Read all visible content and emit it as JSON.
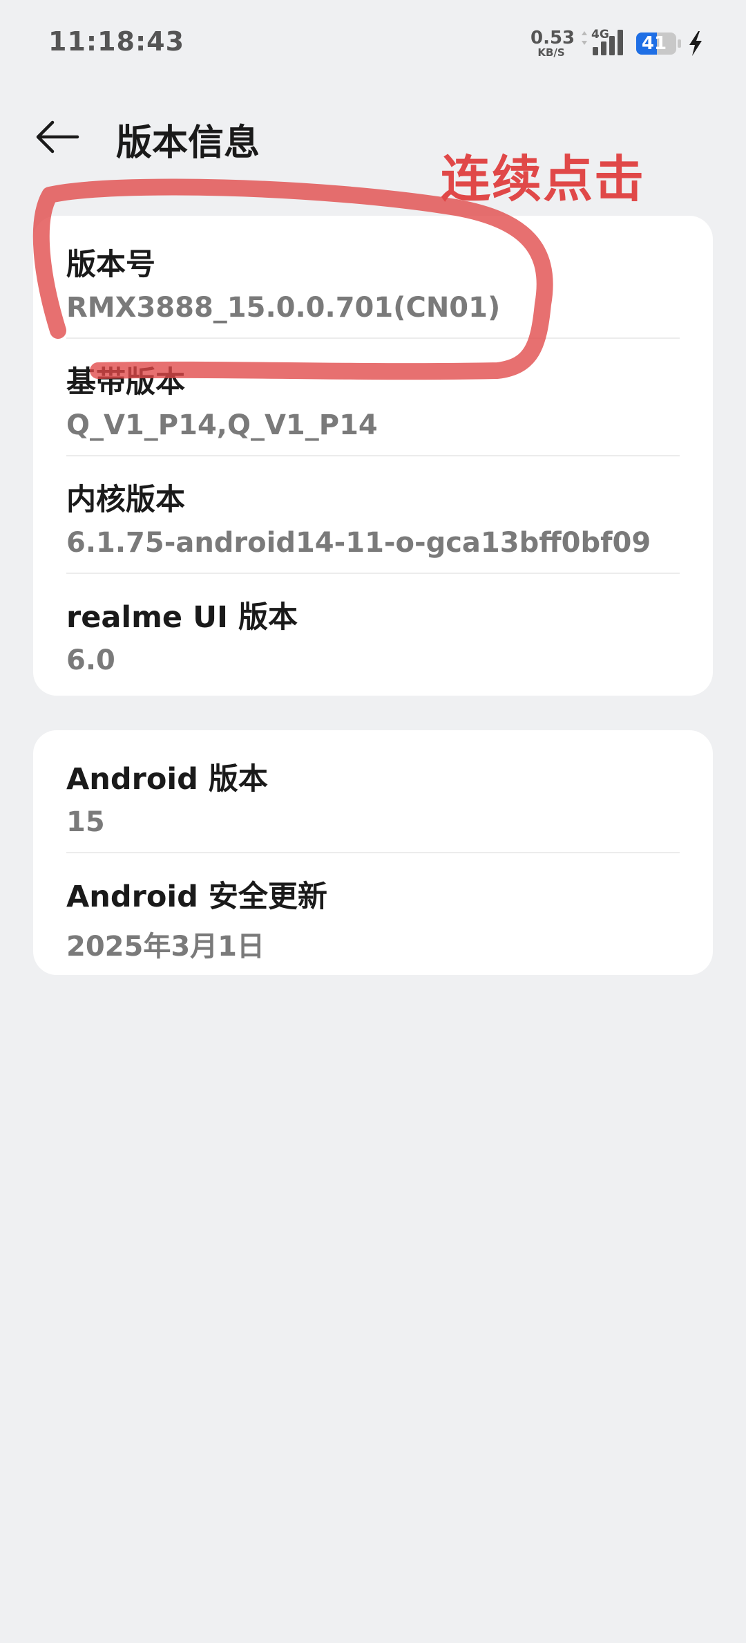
{
  "status_bar": {
    "time": "11:18:43",
    "net_speed_value": "0.53",
    "net_speed_unit": "KB/S",
    "network_type": "4G",
    "battery_level": "41"
  },
  "header": {
    "title": "版本信息"
  },
  "annotation": {
    "text": "连续点击",
    "color": "#e04848"
  },
  "card1": {
    "rows": [
      {
        "title": "版本号",
        "value": "RMX3888_15.0.0.701(CN01)"
      },
      {
        "title": "基带版本",
        "value": "Q_V1_P14,Q_V1_P14"
      },
      {
        "title": "内核版本",
        "value": "6.1.75-android14-11-o-gca13bff0bf09"
      },
      {
        "title": "realme UI 版本",
        "value": "6.0"
      }
    ]
  },
  "card2": {
    "rows": [
      {
        "title": "Android 版本",
        "value": "15"
      },
      {
        "title": "Android 安全更新",
        "value": "2025年3月1日"
      }
    ]
  },
  "icons": {
    "back": "back-arrow-icon",
    "signal": "signal-bars-icon",
    "battery": "battery-icon",
    "charging": "charging-bolt-icon"
  },
  "colors": {
    "background": "#eff0f2",
    "card": "#ffffff",
    "battery_fill": "#1f6fe5",
    "annotation": "#e04848"
  }
}
